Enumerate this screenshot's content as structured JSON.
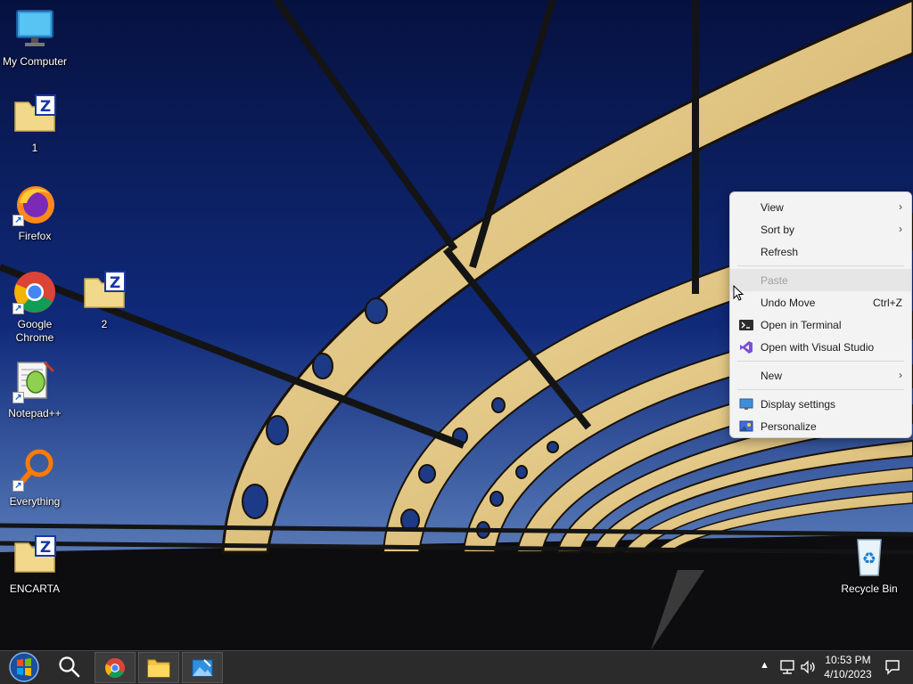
{
  "desktop": {
    "icons": [
      {
        "label": "My Computer"
      },
      {
        "label": "1"
      },
      {
        "label": "Firefox"
      },
      {
        "label": "Google Chrome"
      },
      {
        "label": "2"
      },
      {
        "label": "Notepad++"
      },
      {
        "label": "Everything"
      },
      {
        "label": "ENCARTA"
      },
      {
        "label": "Recycle Bin"
      }
    ]
  },
  "context_menu": {
    "items": [
      {
        "label": "View",
        "submenu": true
      },
      {
        "label": "Sort by",
        "submenu": true
      },
      {
        "label": "Refresh"
      },
      {
        "label": "Paste",
        "disabled": true
      },
      {
        "label": "Undo Move",
        "shortcut": "Ctrl+Z"
      },
      {
        "label": "Open in Terminal",
        "icon": "terminal-icon"
      },
      {
        "label": "Open with Visual Studio",
        "icon": "visual-studio-icon"
      },
      {
        "label": "New",
        "submenu": true
      },
      {
        "label": "Display settings",
        "icon": "display-icon"
      },
      {
        "label": "Personalize",
        "icon": "personalize-icon"
      }
    ]
  },
  "taskbar": {
    "clock_time": "10:53 PM",
    "clock_date": "4/10/2023",
    "pinned": [
      "start-orb-icon",
      "search-icon",
      "chrome-icon",
      "file-explorer-icon",
      "paint-icon"
    ],
    "tray": [
      "chevron-up-icon",
      "network-icon",
      "volume-icon",
      "notification-icon"
    ]
  },
  "colors": {
    "taskbar": "#2b2b2b",
    "menu_bg": "#f3f3f3",
    "sky_top": "#0a1850",
    "sky_bottom": "#4d6fb0"
  }
}
